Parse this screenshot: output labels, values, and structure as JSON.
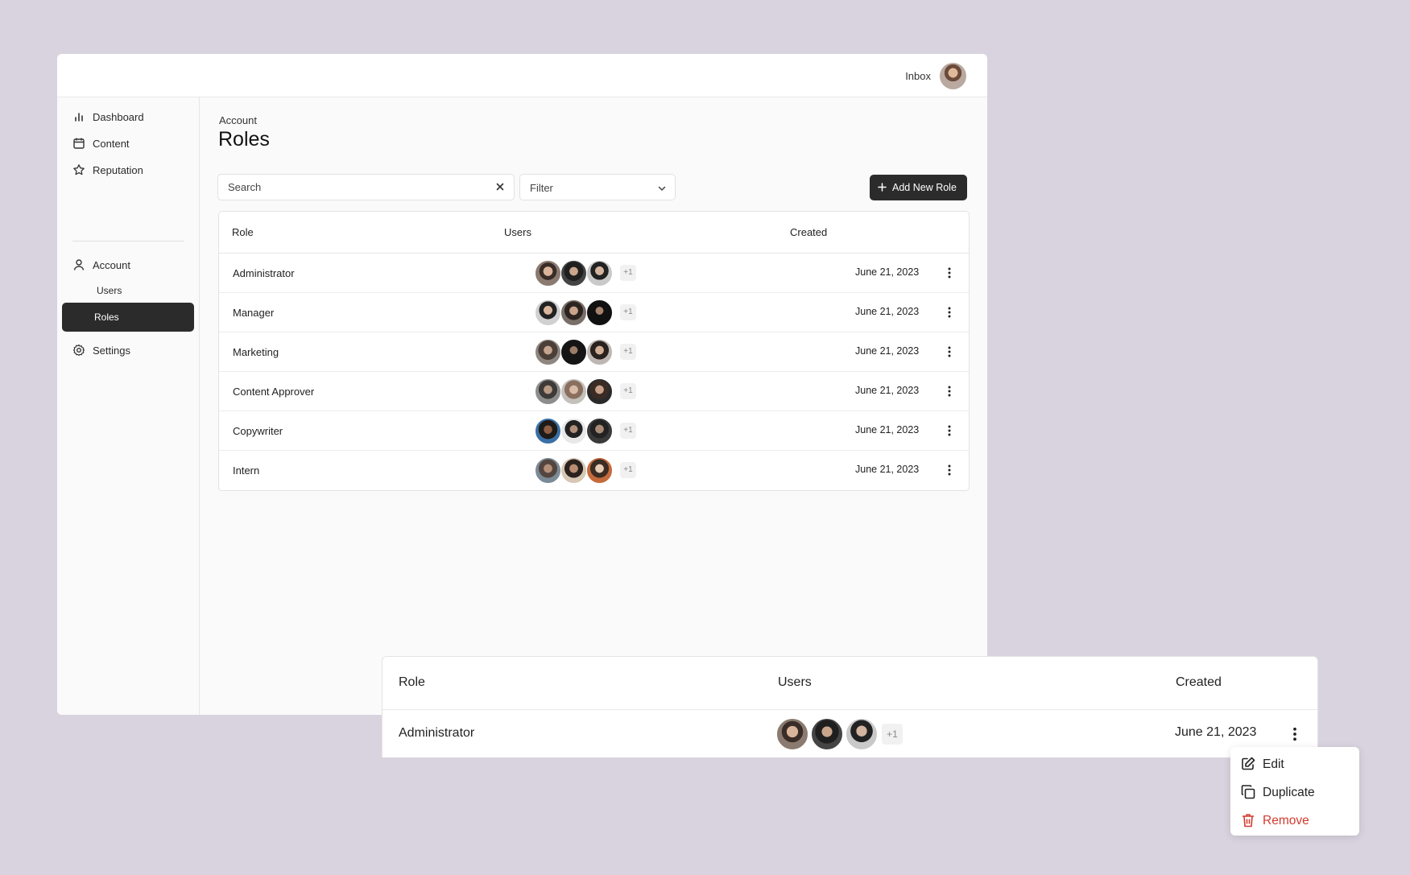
{
  "topbar": {
    "inbox_label": "Inbox"
  },
  "sidebar": {
    "items": [
      {
        "label": "Dashboard"
      },
      {
        "label": "Content"
      },
      {
        "label": "Reputation"
      },
      {
        "label": "Account"
      },
      {
        "label": "Users"
      },
      {
        "label": "Roles"
      },
      {
        "label": "Settings"
      }
    ]
  },
  "main": {
    "breadcrumb": "Account",
    "title": "Roles",
    "search": {
      "placeholder": "Search"
    },
    "filter": {
      "value": "Filter"
    },
    "add_button": "Add New Role",
    "table": {
      "headers": [
        "Role",
        "Users",
        "Created"
      ],
      "rows": [
        {
          "role": "Administrator",
          "extra": "+1",
          "created": "June 21, 2023"
        },
        {
          "role": "Manager",
          "extra": "+1",
          "created": "June 21, 2023"
        },
        {
          "role": "Marketing",
          "extra": "+1",
          "created": "June 21, 2023"
        },
        {
          "role": "Content Approver",
          "extra": "+1",
          "created": "June 21, 2023"
        },
        {
          "role": "Copywriter",
          "extra": "+1",
          "created": "June 21, 2023"
        },
        {
          "role": "Intern",
          "extra": "+1",
          "created": "June 21, 2023"
        }
      ]
    }
  },
  "zoom": {
    "headers": [
      "Role",
      "Users",
      "Created"
    ],
    "row": {
      "role": "Administrator",
      "extra": "+1",
      "created": "June 21, 2023"
    }
  },
  "menu": {
    "items": [
      {
        "label": "Edit",
        "icon": "edit-icon"
      },
      {
        "label": "Duplicate",
        "icon": "duplicate-icon"
      },
      {
        "label": "Remove",
        "icon": "trash-icon",
        "color": "#d23b2f"
      }
    ]
  },
  "colors": {
    "background": "#d9d3df",
    "accent": "#2b2b2b",
    "danger": "#d23b2f"
  }
}
